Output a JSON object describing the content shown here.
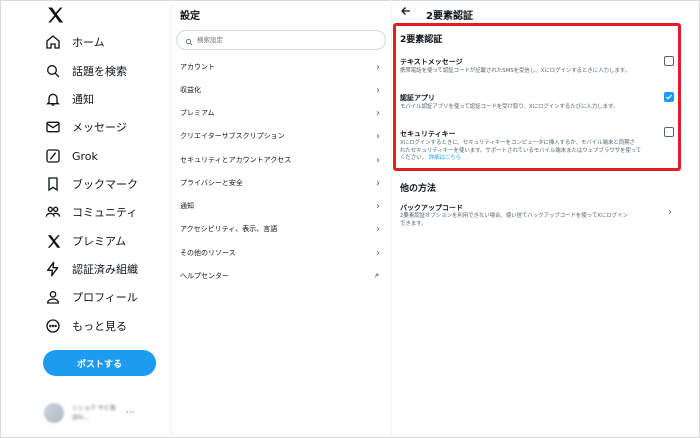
{
  "nav": {
    "items": [
      {
        "label": "ホーム",
        "icon": "home-icon"
      },
      {
        "label": "話題を検索",
        "icon": "search-icon"
      },
      {
        "label": "通知",
        "icon": "bell-icon"
      },
      {
        "label": "メッセージ",
        "icon": "mail-icon"
      },
      {
        "label": "Grok",
        "icon": "grok-icon"
      },
      {
        "label": "ブックマーク",
        "icon": "bookmark-icon"
      },
      {
        "label": "コミュニティ",
        "icon": "community-icon"
      },
      {
        "label": "プレミアム",
        "icon": "x-premium-icon"
      },
      {
        "label": "認証済み組織",
        "icon": "lightning-icon"
      },
      {
        "label": "プロフィール",
        "icon": "profile-icon"
      },
      {
        "label": "もっと見る",
        "icon": "more-icon"
      }
    ],
    "post_button": "ポストする",
    "account": {
      "name": "シショク サビ島",
      "handle": "@lo..."
    }
  },
  "settings": {
    "title": "設定",
    "search_placeholder": "検索設定",
    "items": [
      {
        "label": "アカウント"
      },
      {
        "label": "収益化"
      },
      {
        "label": "プレミアム"
      },
      {
        "label": "クリエイターサブスクリプション"
      },
      {
        "label": "セキュリティとアカウントアクセス"
      },
      {
        "label": "プライバシーと安全"
      },
      {
        "label": "通知"
      },
      {
        "label": "アクセシビリティ、表示、言語"
      },
      {
        "label": "その他のリソース"
      },
      {
        "label": "ヘルプセンター"
      }
    ]
  },
  "detail": {
    "title": "2要素認証",
    "section_title": "2要素認証",
    "options": [
      {
        "title": "テキストメッセージ",
        "desc": "携帯電話を使って認証コードが記載されたSMSを受信し、Xにログインするときに入力します。",
        "checked": false
      },
      {
        "title": "認証アプリ",
        "desc": "モバイル認証アプリを使って認証コードを受け取り、Xにログインするたびに入力します。",
        "checked": true
      },
      {
        "title": "セキュリティキー",
        "desc1": "Xにログインするときに、セキュリティキーをコンピュータに挿入するか、モバイル端末と同期さ",
        "desc2": "れたセキュリティキーを使います。サポートされているモバイル端末またはウェブブラウザを使って",
        "desc3": "ください。",
        "link": "詳細はこちら",
        "checked": false
      }
    ],
    "other_title": "他の方法",
    "backup": {
      "title": "バックアップコード",
      "desc1": "2要素認証オプションを利用できない場合、使い捨てバックアップコードを使ってXにログイン",
      "desc2": "できます。"
    },
    "accent": "#1d9bf0",
    "highlight": "#e02020"
  }
}
